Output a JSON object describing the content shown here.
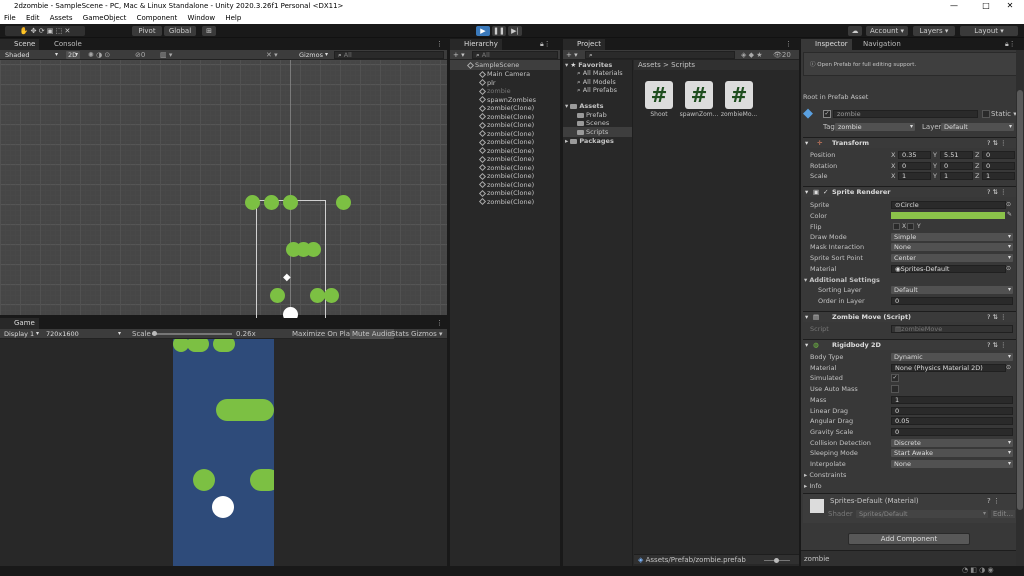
{
  "window": {
    "title": "2dzombie - SampleScene - PC, Mac & Linux Standalone - Unity 2020.3.26f1 Personal <DX11>",
    "minimize": "—",
    "maximize": "□",
    "close": "✕"
  },
  "menu": [
    "File",
    "Edit",
    "Assets",
    "GameObject",
    "Component",
    "Window",
    "Help"
  ],
  "toolbar": {
    "pivot": "Pivot",
    "global": "Global",
    "account": "Account",
    "layers": "Layers",
    "layout": "Layout"
  },
  "scene": {
    "tab_scene": "Scene",
    "tab_console": "Console",
    "shading": "Shaded",
    "mode2d": "2D",
    "layer_count": "0",
    "gizmos": "Gizmos",
    "search": "All"
  },
  "game": {
    "tab": "Game",
    "display": "Display 1",
    "resolution": "720x1600",
    "scale_label": "Scale",
    "scale_value": "0.26x",
    "maximize": "Maximize On Play",
    "mute": "Mute Audio",
    "stats": "Stats",
    "gizmos": "Gizmos"
  },
  "hierarchy": {
    "tab": "Hierarchy",
    "search": "All",
    "scene": "SampleScene",
    "items": [
      "Main Camera",
      "plr",
      "zombie",
      "spawnZombies",
      "zombie(Clone)",
      "zombie(Clone)",
      "zombie(Clone)",
      "zombie(Clone)",
      "zombie(Clone)",
      "zombie(Clone)",
      "zombie(Clone)",
      "zombie(Clone)",
      "zombie(Clone)",
      "zombie(Clone)",
      "zombie(Clone)",
      "zombie(Clone)"
    ]
  },
  "project": {
    "tab": "Project",
    "favorites": "Favorites",
    "fav_items": [
      "All Materials",
      "All Models",
      "All Prefabs"
    ],
    "assets": "Assets",
    "asset_items": [
      "Prefab",
      "Scenes",
      "Scripts"
    ],
    "packages": "Packages",
    "breadcrumb_root": "Assets",
    "breadcrumb_sep": ">",
    "breadcrumb_leaf": "Scripts",
    "scripts": [
      "Shoot",
      "spawnZom...",
      "zombieMo..."
    ],
    "script_glyph": "#",
    "path": "Assets/Prefab/zombie.prefab",
    "count": "20"
  },
  "inspector": {
    "tab": "Inspector",
    "tab2": "Navigation",
    "prefab_hint": "Open Prefab for full editing support.",
    "root_label": "Root in Prefab Asset",
    "name": "zombie",
    "static": "Static",
    "tag_label": "Tag",
    "tag": "zombie",
    "layer_label": "Layer",
    "layer": "Default",
    "transform": {
      "title": "Transform",
      "rows": [
        {
          "label": "Position",
          "x": "0.35",
          "y": "5.51",
          "z": "0"
        },
        {
          "label": "Rotation",
          "x": "0",
          "y": "0",
          "z": "0"
        },
        {
          "label": "Scale",
          "x": "1",
          "y": "1",
          "z": "1"
        }
      ]
    },
    "sprite_renderer": {
      "title": "Sprite Renderer",
      "sprite_label": "Sprite",
      "sprite": "Circle",
      "color_label": "Color",
      "color": "#8bc34a",
      "flip_label": "Flip",
      "flip_x": "X",
      "flip_y": "Y",
      "draw_mode_label": "Draw Mode",
      "draw_mode": "Simple",
      "mask_label": "Mask Interaction",
      "mask": "None",
      "sort_point_label": "Sprite Sort Point",
      "sort_point": "Center",
      "material_label": "Material",
      "material": "Sprites-Default",
      "additional": "Additional Settings",
      "sorting_layer_label": "Sorting Layer",
      "sorting_layer": "Default",
      "order_label": "Order in Layer",
      "order": "0"
    },
    "script": {
      "title": "Zombie Move (Script)",
      "label": "Script",
      "value": "zombieMove"
    },
    "rigidbody": {
      "title": "Rigidbody 2D",
      "rows": [
        {
          "label": "Body Type",
          "value": "Dynamic",
          "kind": "dd"
        },
        {
          "label": "Material",
          "value": "None (Physics Material 2D)",
          "kind": "field"
        },
        {
          "label": "Simulated",
          "value": "✓",
          "kind": "check"
        },
        {
          "label": "Use Auto Mass",
          "value": "",
          "kind": "check"
        },
        {
          "label": "Mass",
          "value": "1",
          "kind": "field"
        },
        {
          "label": "Linear Drag",
          "value": "0",
          "kind": "field"
        },
        {
          "label": "Angular Drag",
          "value": "0.05",
          "kind": "field"
        },
        {
          "label": "Gravity Scale",
          "value": "0",
          "kind": "field"
        },
        {
          "label": "Collision Detection",
          "value": "Discrete",
          "kind": "dd"
        },
        {
          "label": "Sleeping Mode",
          "value": "Start Awake",
          "kind": "dd"
        },
        {
          "label": "Interpolate",
          "value": "None",
          "kind": "dd"
        }
      ],
      "constraints": "Constraints",
      "info": "Info"
    },
    "material_block": {
      "title": "Sprites-Default (Material)",
      "shader_label": "Shader",
      "shader": "Sprites/Default",
      "edit": "Edit..."
    },
    "add_component": "Add Component",
    "footer": "zombie"
  },
  "colors": {
    "zombie_green": "#7cc043",
    "game_bg": "#2e4b7a",
    "play_active": "#3a79bb"
  }
}
